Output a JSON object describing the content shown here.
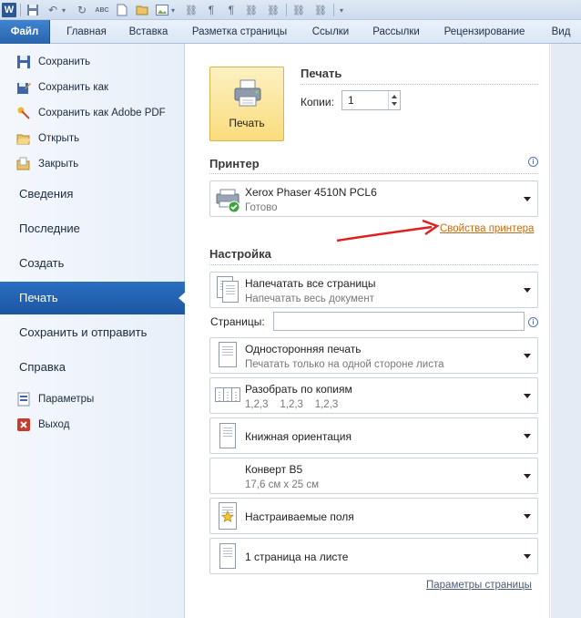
{
  "quick_access": {
    "icons": [
      "word-icon",
      "save-icon",
      "undo-icon",
      "redo-icon",
      "spelling-icon",
      "new-icon",
      "open-icon",
      "image-icon",
      "tree-icon",
      "pilcrow-icon",
      "tree2-icon",
      "tree3-icon",
      "tree4-icon",
      "tree5-icon",
      "customize-icon"
    ]
  },
  "tabs": [
    {
      "label": "Файл",
      "active": true
    },
    {
      "label": "Главная"
    },
    {
      "label": "Вставка"
    },
    {
      "label": "Разметка страницы"
    },
    {
      "label": "Ссылки"
    },
    {
      "label": "Рассылки"
    },
    {
      "label": "Рецензирование"
    },
    {
      "label": "Вид"
    }
  ],
  "nav": {
    "small_items": [
      {
        "label": "Сохранить",
        "icon": "save-icon"
      },
      {
        "label": "Сохранить как",
        "icon": "save-as-icon"
      },
      {
        "label": "Сохранить как Adobe PDF",
        "icon": "pdf-icon"
      },
      {
        "label": "Открыть",
        "icon": "open-folder-icon"
      },
      {
        "label": "Закрыть",
        "icon": "close-folder-icon"
      }
    ],
    "big_items": [
      {
        "label": "Сведения"
      },
      {
        "label": "Последние"
      },
      {
        "label": "Создать"
      },
      {
        "label": "Печать",
        "active": true
      },
      {
        "label": "Сохранить и отправить"
      },
      {
        "label": "Справка"
      }
    ],
    "bottom_items": [
      {
        "label": "Параметры",
        "icon": "options-icon"
      },
      {
        "label": "Выход",
        "icon": "exit-icon"
      }
    ]
  },
  "print": {
    "section_title": "Печать",
    "button_label": "Печать",
    "copies_label": "Копии:",
    "copies_value": "1"
  },
  "printer": {
    "section_title": "Принтер",
    "name": "Xerox Phaser 4510N PCL6",
    "status": "Готово",
    "properties_link": "Свойства принтера",
    "annotation_color": "#e02020"
  },
  "settings": {
    "section_title": "Настройка",
    "pages_label": "Страницы:",
    "pages_value": "",
    "options": [
      {
        "title": "Напечатать все страницы",
        "subtitle": "Напечатать весь документ",
        "icon": "pages-icon"
      },
      {
        "title": "Односторонняя печать",
        "subtitle": "Печатать только на одной стороне листа",
        "icon": "one-sided-icon"
      },
      {
        "title": "Разобрать по копиям",
        "subtitle": "1,2,3    1,2,3    1,2,3",
        "icon": "collate-icon"
      },
      {
        "title": "Книжная ориентация",
        "subtitle": "",
        "icon": "portrait-icon"
      },
      {
        "title": "Конверт B5",
        "subtitle": "17,6 см x 25 см",
        "icon": "envelope-icon"
      },
      {
        "title": "Настраиваемые поля",
        "subtitle": "",
        "icon": "margins-icon"
      },
      {
        "title": "1 страница на листе",
        "subtitle": "",
        "icon": "pages-per-sheet-icon"
      }
    ],
    "page_setup_link": "Параметры страницы"
  }
}
